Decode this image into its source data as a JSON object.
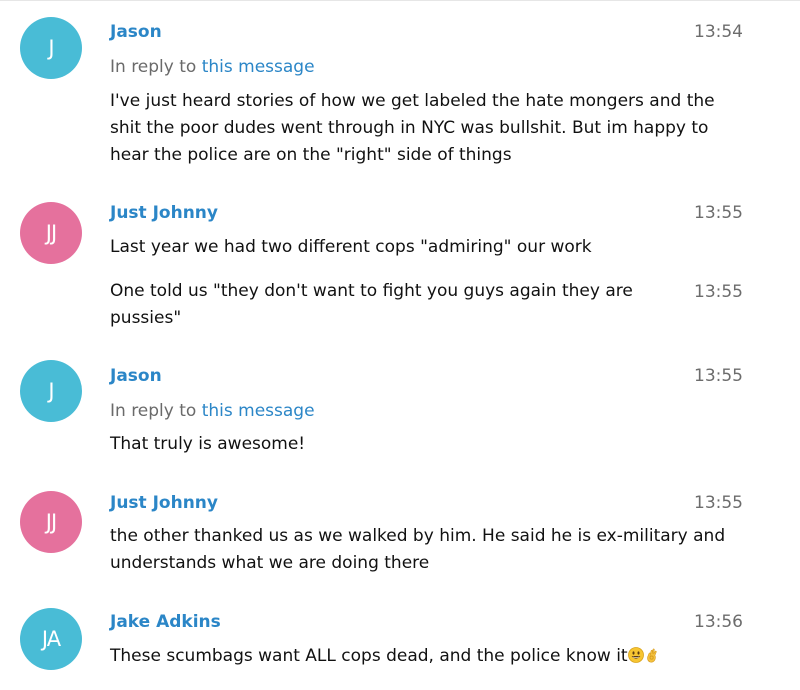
{
  "colors": {
    "sender_name": "#2b86c7",
    "link": "#2b86c7",
    "avatar_blue": "#49bcd6",
    "avatar_pink": "#e5719d",
    "timestamp": "#6c6c6c"
  },
  "messages": [
    {
      "avatar": {
        "initials": "J",
        "color": "blue"
      },
      "sender": "Jason",
      "time": "13:54",
      "reply": {
        "prefix": "In reply to",
        "link": "this message"
      },
      "text": "I've just heard stories of how we get labeled the hate mongers and the shit the poor dudes went through in NYC was bullshit. But im happy to hear the police are on the \"right\" side of things"
    },
    {
      "avatar": {
        "initials": "JJ",
        "color": "pink"
      },
      "sender": "Just Johnny",
      "time": "13:55",
      "text": "Last year we had two different cops \"admiring\" our work"
    },
    {
      "time": "13:55",
      "text": "One told us \"they don't want to fight you guys again they are pussies\""
    },
    {
      "avatar": {
        "initials": "J",
        "color": "blue"
      },
      "sender": "Jason",
      "time": "13:55",
      "reply": {
        "prefix": "In reply to",
        "link": "this message"
      },
      "text": "That truly is awesome!"
    },
    {
      "avatar": {
        "initials": "JJ",
        "color": "pink"
      },
      "sender": "Just Johnny",
      "time": "13:55",
      "text": "the other thanked us as we walked by him. He said he is ex-military and understands what we are doing there"
    },
    {
      "avatar": {
        "initials": "JA",
        "color": "blue"
      },
      "sender": "Jake Adkins",
      "time": "13:56",
      "text": "These scumbags want ALL cops dead, and the police know it",
      "emojis": [
        "smiley-emoji",
        "ok-hand-emoji"
      ]
    }
  ]
}
